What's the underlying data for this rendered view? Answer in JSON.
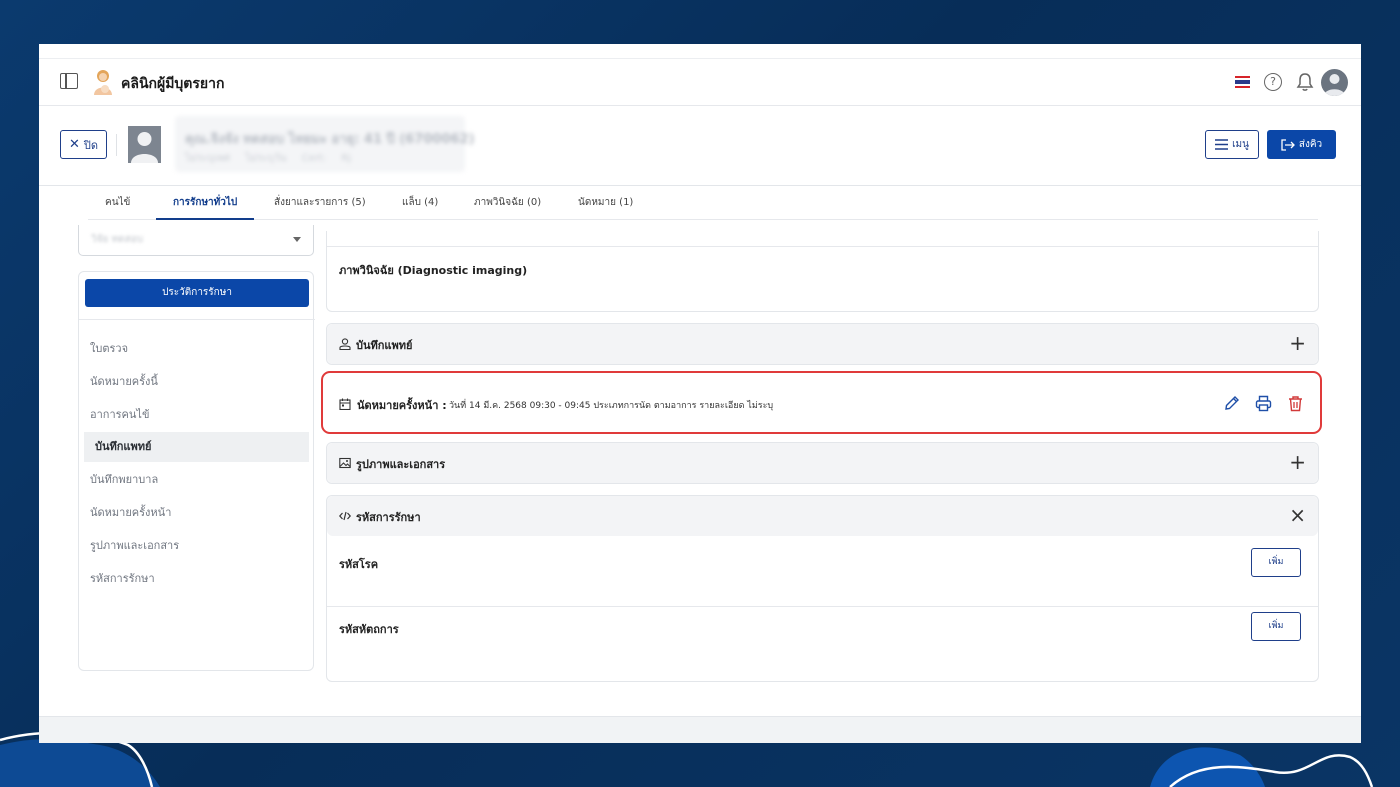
{
  "header": {
    "clinic_name": "คลินิกผู้มีบุตรยาก",
    "help_glyph": "?"
  },
  "patient": {
    "name": "คุณ.จิงจัง ทดสอบ  ไทยมะ อายุ: 41 ปี (6700062)",
    "sub": "ไม่ระบุเพศ  ไม่ระบุวัน  Cert: Rj"
  },
  "buttons": {
    "close": "ปิด",
    "menu": "เมนู",
    "queue": "ส่งคิว",
    "history": "ประวัติการรักษา",
    "add": "เพิ่ม"
  },
  "tabs": [
    {
      "label": "คนไข้"
    },
    {
      "label": "การรักษาทั่วไป"
    },
    {
      "label": "สั่งยาและรายการ (5)"
    },
    {
      "label": "แล็บ (4)"
    },
    {
      "label": "ภาพวินิจฉัย (0)"
    },
    {
      "label": "นัดหมาย (1)"
    }
  ],
  "select": {
    "value": "วิจัย ทดสอบ"
  },
  "sidebar": {
    "items": [
      {
        "label": "ใบตรวจ"
      },
      {
        "label": "นัดหมายครั้งนี้"
      },
      {
        "label": "อาการคนไข้"
      },
      {
        "label": "บันทึกแพทย์"
      },
      {
        "label": "บันทึกพยาบาล"
      },
      {
        "label": "นัดหมายครั้งหน้า"
      },
      {
        "label": "รูปภาพและเอกสาร"
      },
      {
        "label": "รหัสการรักษา"
      }
    ]
  },
  "sections": {
    "imaging_title": "ภาพวินิจฉัย (Diagnostic imaging)",
    "doctor_notes": "บันทึกแพทย์",
    "next_appointment": {
      "title": "นัดหมายครั้งหน้า :",
      "detail": "วันที่ 14 มี.ค. 2568 09:30 - 09:45   ประเภทการนัด ตามอาการ   รายละเอียด ไม่ระบุ"
    },
    "media": "รูปภาพและเอกสาร",
    "codes": {
      "title": "รหัสการรักษา",
      "disease_code": "รหัสโรค",
      "procedure_code": "รหัสหัตถการ"
    }
  },
  "icons": {
    "expand": "+",
    "collapse": "×"
  },
  "colors": {
    "primary": "#0b47a8",
    "highlight_border": "#e03a3a",
    "delete": "#d23a3a",
    "background": "#072d58"
  }
}
